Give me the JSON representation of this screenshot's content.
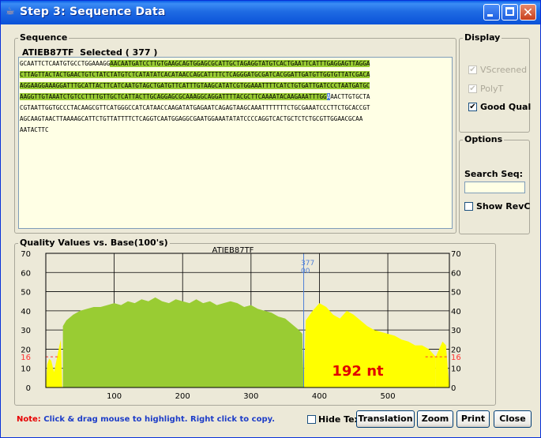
{
  "window": {
    "title": "Step 3: Sequence Data",
    "icon": "java-cup-icon",
    "controls": [
      "minimize-button",
      "maximize-button",
      "close-button"
    ]
  },
  "sequence": {
    "group_title": "Sequence",
    "read_name": "ATIEB87TF",
    "selected_label": "Selected ( 377 )",
    "lines": [
      {
        "pre": "GCAATTCTCAATGTGCCTGGAAAGG",
        "hl": "AACAATGATCCTTGTGAAGCAGTGGAGCGCATTGCTAGAGGTATGTCACTGAATTCATTTGAGGAGTTAGGA",
        "post": ""
      },
      {
        "pre": "",
        "hl": "CTTAGTTACTACTGAACTGTCTATCTATGTCTCATATATCACATAACCAGCATTTTCTCAGGGATGCGATCACGGATTGATGTTGGTGTTATCGACA",
        "post": ""
      },
      {
        "pre": "",
        "hl": "AGGAAGGAAAGGATTTGCATTACTTCATCAATGTAGCTGATGTTCATTTGTAAGCATATCGTGGAAATTTTCATCTGTGATTGATCCCTAATGATGC",
        "post": ""
      },
      {
        "pre": "",
        "hl": "AAGGTTGTAAATCTGTCCTTTTGTTGCTCATTACTTGCAGGAGCGCAAAGGCAGGATTTTACGCTTCAAAATACAAGAAATTTGG",
        "cur": "A",
        "post": "AACTTGTGCTA"
      },
      {
        "pre": "CGTAATTGGTGCCCTACAAGCGTTCATGGGCCATCATAACCAAGATATGAGAATCAGAGTAAGCAAATTTTTTTCTGCGAAATCCCTTCTGCACCGT",
        "hl": "",
        "post": ""
      },
      {
        "pre": "AGCAAGTAACTTAAAAGCATTCTGTTATTTTCTCAGGTCAATGGAGGCGAATGGAAATATATCCCCAGGTCACTGCTCTCTGCGTTGGAACGCAA",
        "hl": "",
        "post": ""
      },
      {
        "pre": "AATACTTC",
        "hl": "",
        "post": ""
      }
    ]
  },
  "display": {
    "group_title": "Display",
    "vscreened": {
      "label": "VScreened",
      "checked": true,
      "enabled": false
    },
    "polyt": {
      "label": "PolyT",
      "checked": true,
      "enabled": false
    },
    "good_qual": {
      "label": "Good Qual",
      "checked": true,
      "enabled": true
    }
  },
  "options": {
    "group_title": "Options",
    "search_label": "Search Seq:",
    "search_value": "",
    "show_revc": {
      "label": "Show RevC",
      "checked": false
    }
  },
  "quality": {
    "group_title": "Quality Values vs. Base(100's)",
    "chart_title": "ATIEB87TF",
    "cursor_label_top": "377",
    "cursor_label_bottom": "00",
    "threshold_label": "16",
    "nt_label": "192 nt",
    "colors": {
      "good": "#99cc33",
      "selected": "#ffff00",
      "threshold": "#ff3333",
      "cursor": "#4f7fd6",
      "nt": "#e00000"
    }
  },
  "chart_data": {
    "type": "area",
    "title": "ATIEB87TF",
    "xlabel": "",
    "ylabel": "",
    "ylim": [
      0,
      70
    ],
    "xlim": [
      0,
      590
    ],
    "x_ticks": [
      100,
      200,
      300,
      400,
      500
    ],
    "y_ticks": [
      0,
      10,
      20,
      30,
      40,
      50,
      60,
      70
    ],
    "threshold": 16,
    "cursor_x": 377,
    "grid": true,
    "segments": [
      {
        "name": "",
        "color": "#99cc33",
        "x_range": [
          25,
          377
        ]
      },
      {
        "name": "",
        "color": "#ffff00",
        "x_range": [
          377,
          570
        ]
      }
    ],
    "profile": [
      [
        2,
        12
      ],
      [
        5,
        15
      ],
      [
        8,
        14
      ],
      [
        12,
        8
      ],
      [
        20,
        22
      ],
      [
        22,
        25
      ],
      [
        25,
        32
      ],
      [
        30,
        35
      ],
      [
        40,
        38
      ],
      [
        50,
        40
      ],
      [
        60,
        41
      ],
      [
        70,
        42
      ],
      [
        80,
        42
      ],
      [
        90,
        43
      ],
      [
        100,
        44
      ],
      [
        110,
        43
      ],
      [
        120,
        45
      ],
      [
        130,
        44
      ],
      [
        140,
        46
      ],
      [
        150,
        45
      ],
      [
        160,
        47
      ],
      [
        170,
        45
      ],
      [
        180,
        44
      ],
      [
        190,
        46
      ],
      [
        200,
        45
      ],
      [
        210,
        44
      ],
      [
        220,
        46
      ],
      [
        230,
        44
      ],
      [
        240,
        45
      ],
      [
        250,
        43
      ],
      [
        260,
        44
      ],
      [
        270,
        45
      ],
      [
        280,
        44
      ],
      [
        290,
        42
      ],
      [
        300,
        43
      ],
      [
        310,
        41
      ],
      [
        320,
        40
      ],
      [
        330,
        39
      ],
      [
        340,
        37
      ],
      [
        350,
        36
      ],
      [
        360,
        33
      ],
      [
        370,
        30
      ],
      [
        375,
        28
      ],
      [
        380,
        35
      ],
      [
        390,
        40
      ],
      [
        400,
        44
      ],
      [
        410,
        42
      ],
      [
        420,
        38
      ],
      [
        430,
        36
      ],
      [
        440,
        40
      ],
      [
        450,
        38
      ],
      [
        460,
        35
      ],
      [
        470,
        32
      ],
      [
        480,
        30
      ],
      [
        490,
        29
      ],
      [
        500,
        28
      ],
      [
        510,
        27
      ],
      [
        520,
        25
      ],
      [
        530,
        24
      ],
      [
        540,
        22
      ],
      [
        550,
        22
      ],
      [
        560,
        20
      ],
      [
        565,
        18
      ],
      [
        570,
        16
      ],
      [
        575,
        20
      ],
      [
        580,
        24
      ],
      [
        585,
        22
      ]
    ]
  },
  "footer": {
    "note_label": "Note:",
    "note_text": " Click & drag mouse to highlight. Right click to copy.",
    "hide_text": {
      "label": "Hide Text",
      "checked": false
    },
    "buttons": {
      "translation": "Translation",
      "zoom": "Zoom",
      "print": "Print",
      "close": "Close"
    }
  }
}
